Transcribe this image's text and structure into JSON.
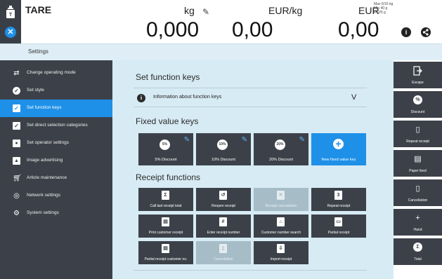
{
  "display": {
    "tare_label": "TARE",
    "unit_weight": "kg",
    "unit_price_per_kg": "EUR/kg",
    "unit_total": "EUR",
    "weight_value": "0,000",
    "price_value": "0,00",
    "total_value": "0,00",
    "specs": [
      "Max 6/15 kg",
      "Min 40 g",
      "e=2/5 g"
    ]
  },
  "header": {
    "title": "Settings"
  },
  "sidebar": {
    "items": [
      {
        "label": "Change operating mode",
        "icon": "swap-arrows-icon"
      },
      {
        "label": "Set style",
        "icon": "check-circle-icon"
      },
      {
        "label": "Set function keys",
        "icon": "checkbox-icon",
        "active": true
      },
      {
        "label": "Set direct selection categories",
        "icon": "checkbox-icon"
      },
      {
        "label": "Set operator settings",
        "icon": "operator-icon"
      },
      {
        "label": "Image advertising",
        "icon": "image-icon"
      },
      {
        "label": "Article maintenance",
        "icon": "cart-icon"
      },
      {
        "label": "Network settings",
        "icon": "network-icon"
      },
      {
        "label": "System settings",
        "icon": "gear-icon"
      }
    ]
  },
  "main": {
    "title": "Set function keys",
    "info_label": "Information about function keys",
    "info_toggle": "V",
    "fixed_title": "Fixed value keys",
    "fixed_keys": [
      {
        "badge": "5%",
        "label": "5% Discount"
      },
      {
        "badge": "10%",
        "label": "10% Discount"
      },
      {
        "badge": "20%",
        "label": "20% Discount"
      },
      {
        "badge": "+",
        "label": "New fixed value key"
      }
    ],
    "receipt_title": "Receipt functions",
    "receipt_keys": [
      {
        "label": "Call last receipt total",
        "enabled": true
      },
      {
        "label": "Reopen receipt",
        "enabled": true
      },
      {
        "label": "Receipt cancellation",
        "enabled": false
      },
      {
        "label": "Repeat receipt",
        "enabled": true
      },
      {
        "label": "Print customer receipt",
        "enabled": true
      },
      {
        "label": "Enter receipt number",
        "enabled": true
      },
      {
        "label": "Customer number search",
        "enabled": true
      },
      {
        "label": "Partial receipt",
        "enabled": true
      },
      {
        "label": "Partial receipt customer no.",
        "enabled": true
      },
      {
        "label": "Cancellation",
        "enabled": false
      },
      {
        "label": "Import receipt",
        "enabled": true
      }
    ]
  },
  "actions": [
    {
      "label": "Escape",
      "icon": "exit-icon"
    },
    {
      "label": "Discount",
      "icon": "percent-icon",
      "glyph": "%"
    },
    {
      "label": "Repeat receipt",
      "icon": "repeat-receipt-icon"
    },
    {
      "label": "Paper feed",
      "icon": "printer-icon"
    },
    {
      "label": "Cancellation",
      "icon": "trash-icon"
    },
    {
      "label": "Hand",
      "icon": "plus-icon",
      "glyph": "+"
    },
    {
      "label": "Total",
      "icon": "sigma-icon",
      "glyph": "Σ"
    }
  ]
}
